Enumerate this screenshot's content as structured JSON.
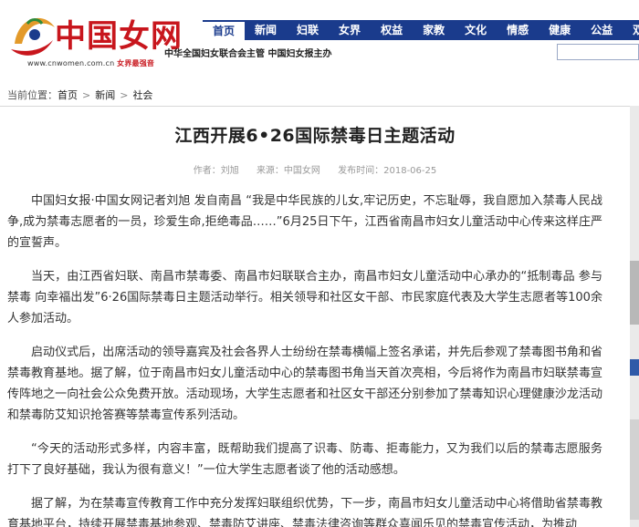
{
  "header": {
    "logo_text": "中国女网",
    "logo_url": "www.cnwomen.com.cn",
    "logo_url_tag": "女界最强音",
    "sponsor": "中华全国妇女联合会主管   中国妇女报主办",
    "nav": [
      "首页",
      "新闻",
      "妇联",
      "女界",
      "权益",
      "家教",
      "文化",
      "情感",
      "健康",
      "公益",
      "双创"
    ]
  },
  "breadcrumb": {
    "prefix": "当前位置：",
    "items": [
      "首页",
      "新闻",
      "社会"
    ]
  },
  "article": {
    "title": "江西开展6•26国际禁毒日主题活动",
    "author": "作者：刘旭",
    "source": "来源：中国女网",
    "date": "发布时间：2018-06-25",
    "paragraphs": [
      "中国妇女报·中国女网记者刘旭 发自南昌  “我是中华民族的儿女,牢记历史，不忘耻辱，我自愿加入禁毒人民战争,成为禁毒志愿者的一员，珍爱生命,拒绝毒品……”6月25日下午，江西省南昌市妇女儿童活动中心传来这样庄严的宣誓声。",
      "当天，由江西省妇联、南昌市禁毒委、南昌市妇联联合主办，南昌市妇女儿童活动中心承办的“抵制毒品 参与禁毒 向幸福出发”6·26国际禁毒日主题活动举行。相关领导和社区女干部、市民家庭代表及大学生志愿者等100余人参加活动。",
      "启动仪式后，出席活动的领导嘉宾及社会各界人士纷纷在禁毒横幅上签名承诺，并先后参观了禁毒图书角和省禁毒教育基地。据了解，位于南昌市妇女儿童活动中心的禁毒图书角当天首次亮相，今后将作为南昌市妇联禁毒宣传阵地之一向社会公众免费开放。活动现场，大学生志愿者和社区女干部还分别参加了禁毒知识心理健康沙龙活动和禁毒防艾知识抢答赛等禁毒宣传系列活动。",
      "“今天的活动形式多样，内容丰富，既帮助我们提高了识毒、防毒、拒毒能力，又为我们以后的禁毒志愿服务打下了良好基础，我认为很有意义！”一位大学生志愿者谈了他的活动感想。",
      "据了解，为在禁毒宣传教育工作中充分发挥妇联组织优势，下一步，南昌市妇女儿童活动中心将借助省禁毒教育基地平台，持续开展禁毒基地参观、禁毒防艾讲座、禁毒法律咨询等群众喜闻乐见的禁毒宣传活动，为推动"
    ]
  },
  "colors": {
    "brand_red": "#c8161d",
    "nav_blue": "#1a3b8c"
  }
}
